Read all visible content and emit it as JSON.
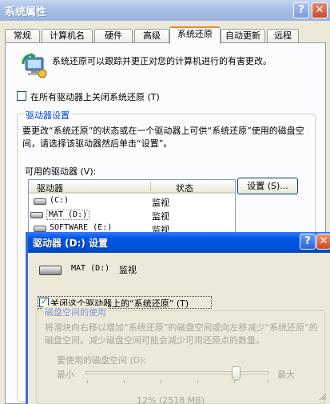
{
  "main_window": {
    "title": "系统属性",
    "help_glyph": "?",
    "close_glyph": "✕",
    "tabs": [
      {
        "label": "常规"
      },
      {
        "label": "计算机名"
      },
      {
        "label": "硬件"
      },
      {
        "label": "高级"
      },
      {
        "label": "系统还原",
        "active": true
      },
      {
        "label": "自动更新"
      },
      {
        "label": "远程"
      }
    ],
    "intro_text": "系统还原可以跟踪并更正对您的计算机进行的有害更改。",
    "turn_off_all": {
      "label": "在所有驱动器上关闭系统还原 (T)",
      "checked": false
    },
    "drive_settings": {
      "title": "驱动器设置",
      "description": "要更改“系统还原”的状态或在一个驱动器上可供“系统还原”使用的磁盘空间，请选择该驱动器然后单击“设置”。",
      "available_label": "可用的驱动器 (V):",
      "columns": [
        "驱动器",
        "状态"
      ],
      "rows": [
        {
          "drive": "(C:)",
          "status": "监视"
        },
        {
          "drive": "MAT (D:)",
          "status": "监视",
          "selected": true
        },
        {
          "drive": "SOFTWARE (E:)",
          "status": "监视"
        }
      ],
      "settings_button": "设置 (S)..."
    }
  },
  "dialog": {
    "title": "驱动器 (D:) 设置",
    "help_glyph": "?",
    "close_glyph": "✕",
    "drive_name": "MAT (D:)",
    "drive_status": "监视",
    "turn_off_drive": {
      "label": "关闭这个驱动器上的“系统还原” (T)",
      "checked": true
    },
    "disk_usage": {
      "title": "磁盘空间的使用",
      "description": "将滑块向右移以增加“系统还原”的磁盘空间或向左移减少“系统还原”的磁盘空间。减少磁盘空间可能会减少可用还原点的数量。",
      "space_label": "要使用的磁盘空间 (D):",
      "min_label": "最小",
      "max_label": "最大",
      "level": 0.82,
      "value_text": "12% (2518 MB)"
    }
  },
  "colors": {
    "inactive_title": "#a9bfe6",
    "active_title": "#0050d8",
    "tab_highlight": "#e68b2c",
    "group_title": "#0046d5"
  }
}
